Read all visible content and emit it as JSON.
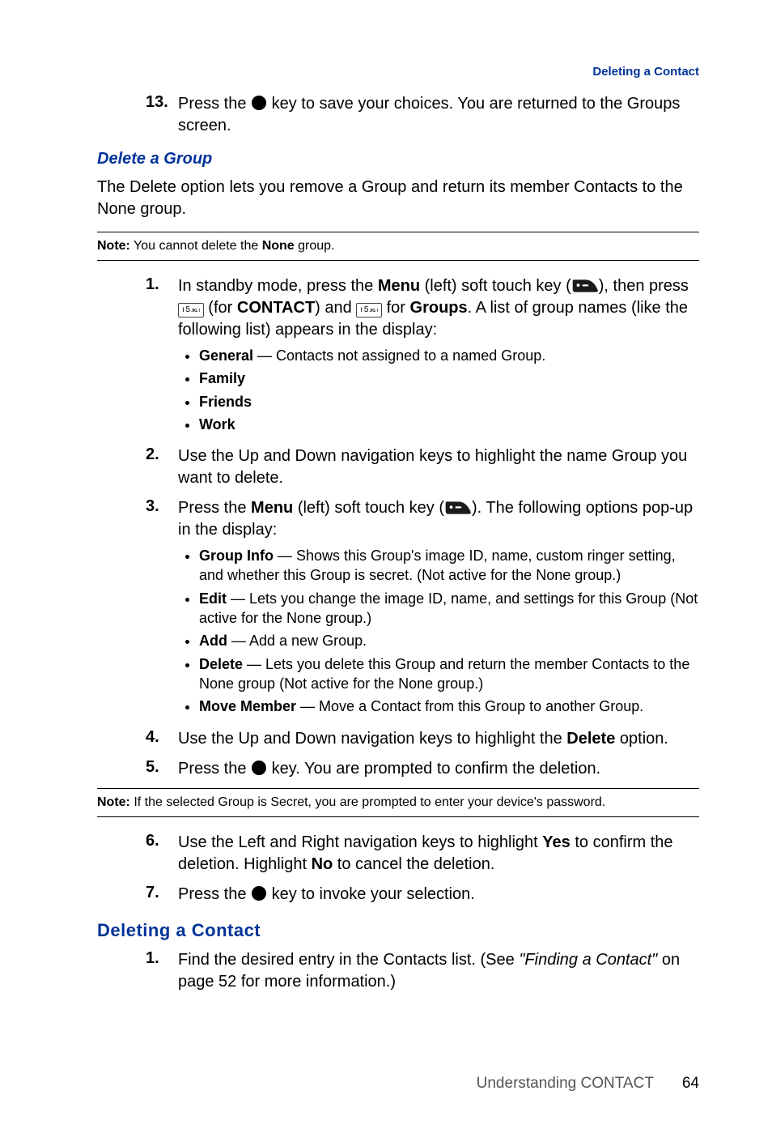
{
  "header_link": "Deleting a Contact",
  "continued": {
    "step13_num": "13.",
    "step13_a": "Press the ",
    "step13_b": " key to save your choices. You are returned to the Groups screen."
  },
  "delete_group": {
    "heading": "Delete a Group",
    "intro": "The Delete option lets you remove a Group and return its member Contacts to the None group.",
    "note_label": "Note:",
    "note_a": " You cannot delete the ",
    "note_bold": "None",
    "note_b": " group.",
    "steps": {
      "s1": {
        "num": "1.",
        "a": "In standby mode, press the ",
        "menu": "Menu",
        "b": " (left) soft touch key (",
        "c": "), then press ",
        "d": " (for ",
        "contact": "CONTACT",
        "e": ") and ",
        "f": " for ",
        "groups": "Groups",
        "g": ". A list of group names (like the following list) appears in the display:",
        "sub": [
          {
            "b": "General",
            "t": " — Contacts not assigned to a named Group."
          },
          {
            "b": "Family",
            "t": ""
          },
          {
            "b": "Friends",
            "t": ""
          },
          {
            "b": "Work",
            "t": ""
          }
        ]
      },
      "s2": {
        "num": "2.",
        "t": "Use the Up and Down navigation keys to highlight the name Group you want to delete."
      },
      "s3": {
        "num": "3.",
        "a": "Press the ",
        "menu": "Menu",
        "b": " (left) soft touch key (",
        "c": "). The following options pop-up in the display:",
        "sub": [
          {
            "b": "Group Info",
            "t": " — Shows this Group's image ID, name, custom ringer setting, and whether this Group is secret. (Not active for the None group.)"
          },
          {
            "b": "Edit",
            "t": " — Lets you change the image ID, name, and settings for this Group (Not active for the None group.)"
          },
          {
            "b": "Add",
            "t": " — Add a new Group."
          },
          {
            "b": "Delete",
            "t": " — Lets you delete this Group and return the member Contacts to the None group (Not active for the None group.)"
          },
          {
            "b": "Move Member",
            "t": " — Move a Contact from this Group to another Group."
          }
        ]
      },
      "s4": {
        "num": "4.",
        "a": "Use the Up and Down navigation keys to highlight the ",
        "delete": "Delete",
        "b": " option."
      },
      "s5": {
        "num": "5.",
        "a": "Press the ",
        "b": " key. You are prompted to confirm the deletion."
      },
      "note2_label": "Note:",
      "note2_t": " If the selected Group is Secret, you are prompted to enter your device's password.",
      "s6": {
        "num": "6.",
        "a": "Use the Left and Right navigation keys to highlight ",
        "yes": "Yes",
        "b": " to confirm the deletion. Highlight ",
        "no": "No",
        "c": " to cancel the deletion."
      },
      "s7": {
        "num": "7.",
        "a": "Press the ",
        "b": " key to invoke your selection."
      }
    }
  },
  "deleting_contact": {
    "heading": "Deleting a Contact",
    "s1": {
      "num": "1.",
      "a": "Find the desired entry in the Contacts list. (See ",
      "link": "\"Finding a Contact\"",
      "b": " on page 52 for more information.)"
    }
  },
  "footer": {
    "chapter": "Understanding CONTACT",
    "page": "64"
  }
}
